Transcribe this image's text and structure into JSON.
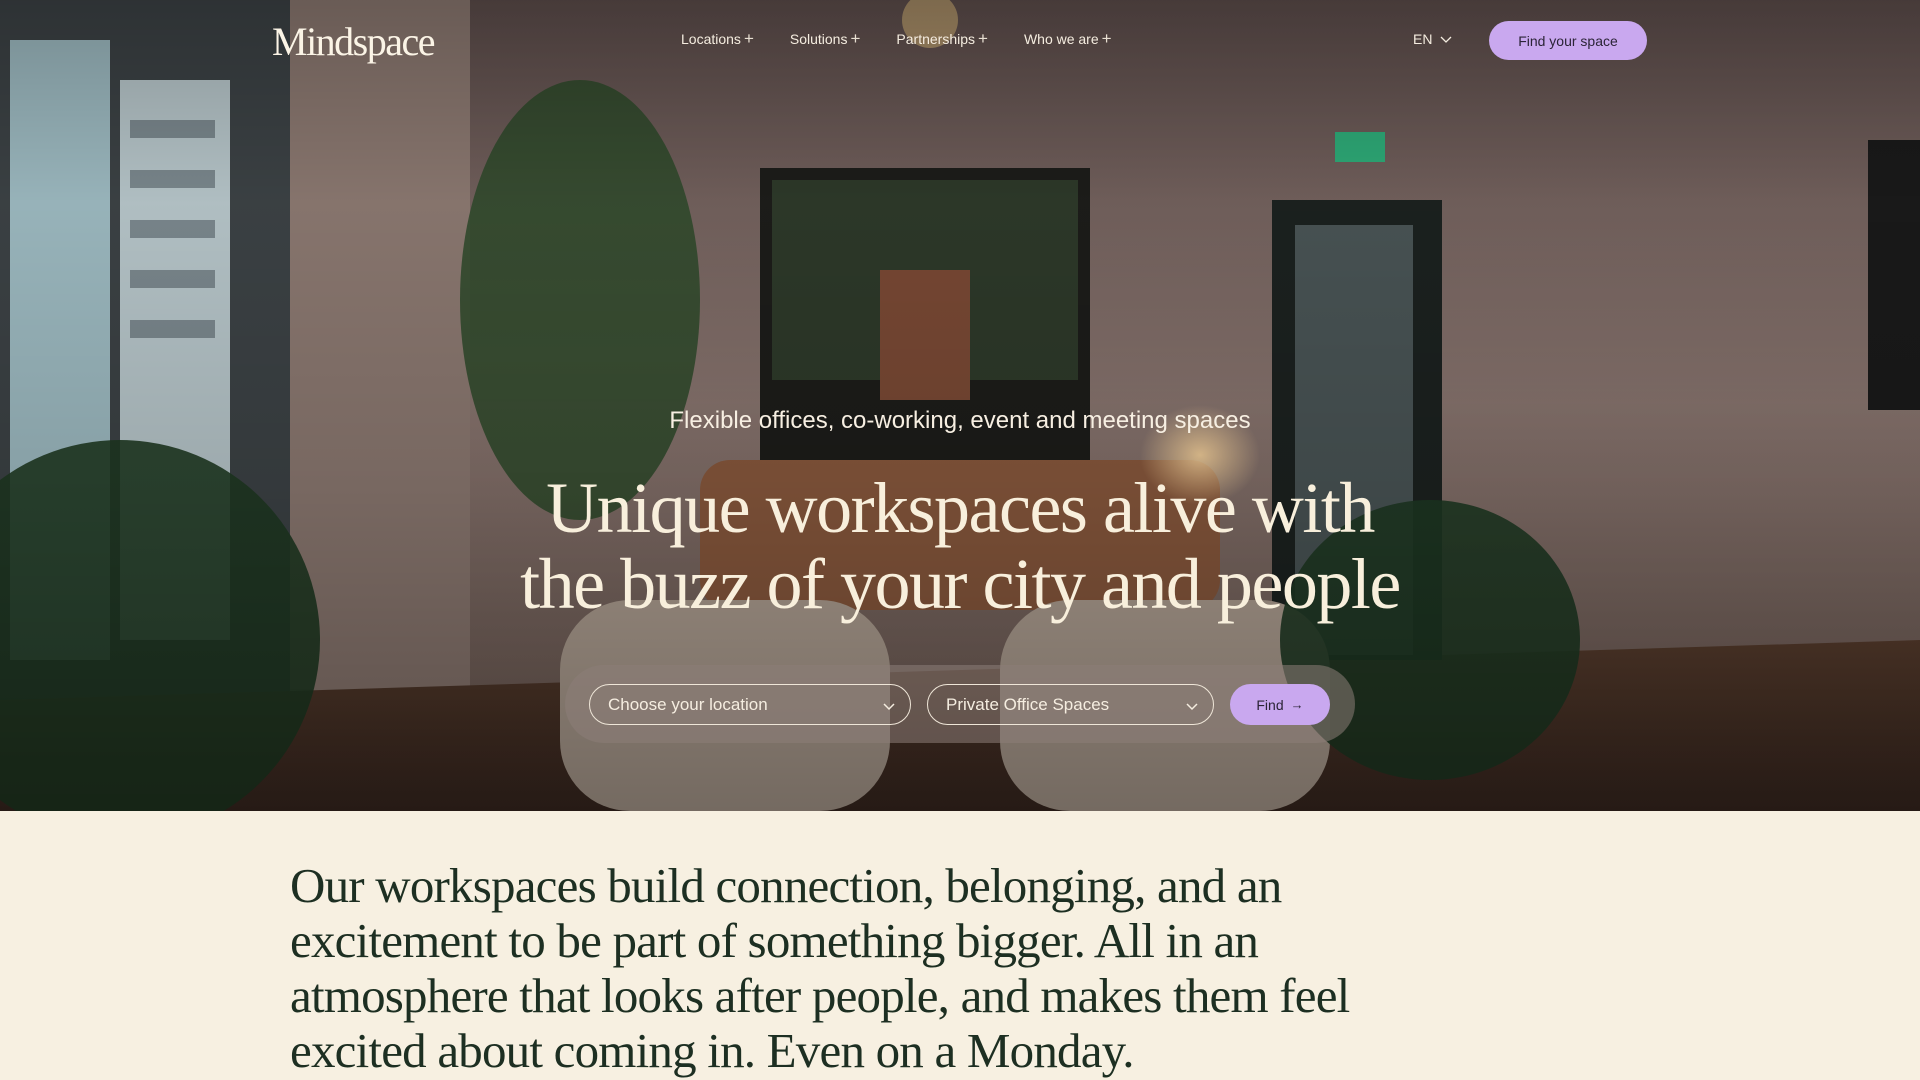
{
  "nav": {
    "logo": "Mindspace",
    "items": [
      {
        "label": "Locations"
      },
      {
        "label": "Solutions"
      },
      {
        "label": "Partnerships"
      },
      {
        "label": "Who we are"
      }
    ],
    "lang": "EN",
    "cta": "Find your space"
  },
  "hero": {
    "tagline": "Flexible offices, co-working, event and meeting spaces",
    "headline_line1": "Unique workspaces alive with",
    "headline_line2": "the buzz of your city and people"
  },
  "search": {
    "location_placeholder": "Choose your location",
    "space_type": "Private Office Spaces",
    "find_label": "Find"
  },
  "intro": {
    "text": "Our workspaces build connection, belonging, and an excitement to be part of something bigger. All in an atmosphere that looks after people, and makes them feel excited about coming in. Even on a Monday."
  },
  "colors": {
    "accent": "#c9a8ef",
    "cream": "#f7f0e1",
    "dark_green": "#1d2f22"
  },
  "icons": [
    "plus-icon",
    "chevron-down-icon",
    "arrow-right-icon"
  ]
}
